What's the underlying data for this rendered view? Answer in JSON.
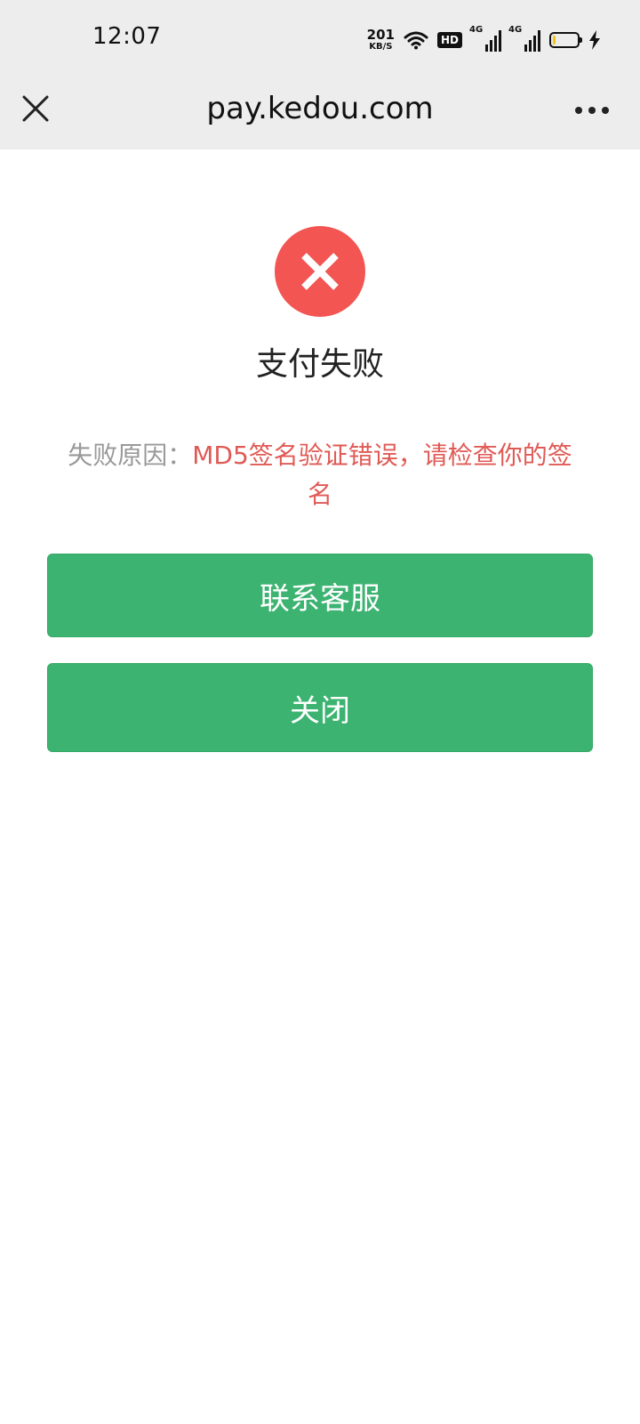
{
  "status_bar": {
    "time": "12:07",
    "net_speed_value": "201",
    "net_speed_unit": "KB/S",
    "hd_label": "HD",
    "signal1_label": "4G",
    "signal2_label": "4G",
    "battery_level": 0.12,
    "battery_color": "#f0c419"
  },
  "nav": {
    "close_icon": "close-icon",
    "title": "pay.kedou.com",
    "more_icon": "more-dots-icon"
  },
  "result": {
    "icon": "error-x-icon",
    "icon_color": "#f25552",
    "title": "支付失败",
    "reason_label": "失败原因：",
    "reason_message": "MD5签名验证错误，请检查你的签名",
    "reason_label_color": "#999999",
    "reason_message_color": "#e05a55"
  },
  "buttons": {
    "contact_label": "联系客服",
    "close_label": "关闭",
    "color": "#3cb371"
  }
}
